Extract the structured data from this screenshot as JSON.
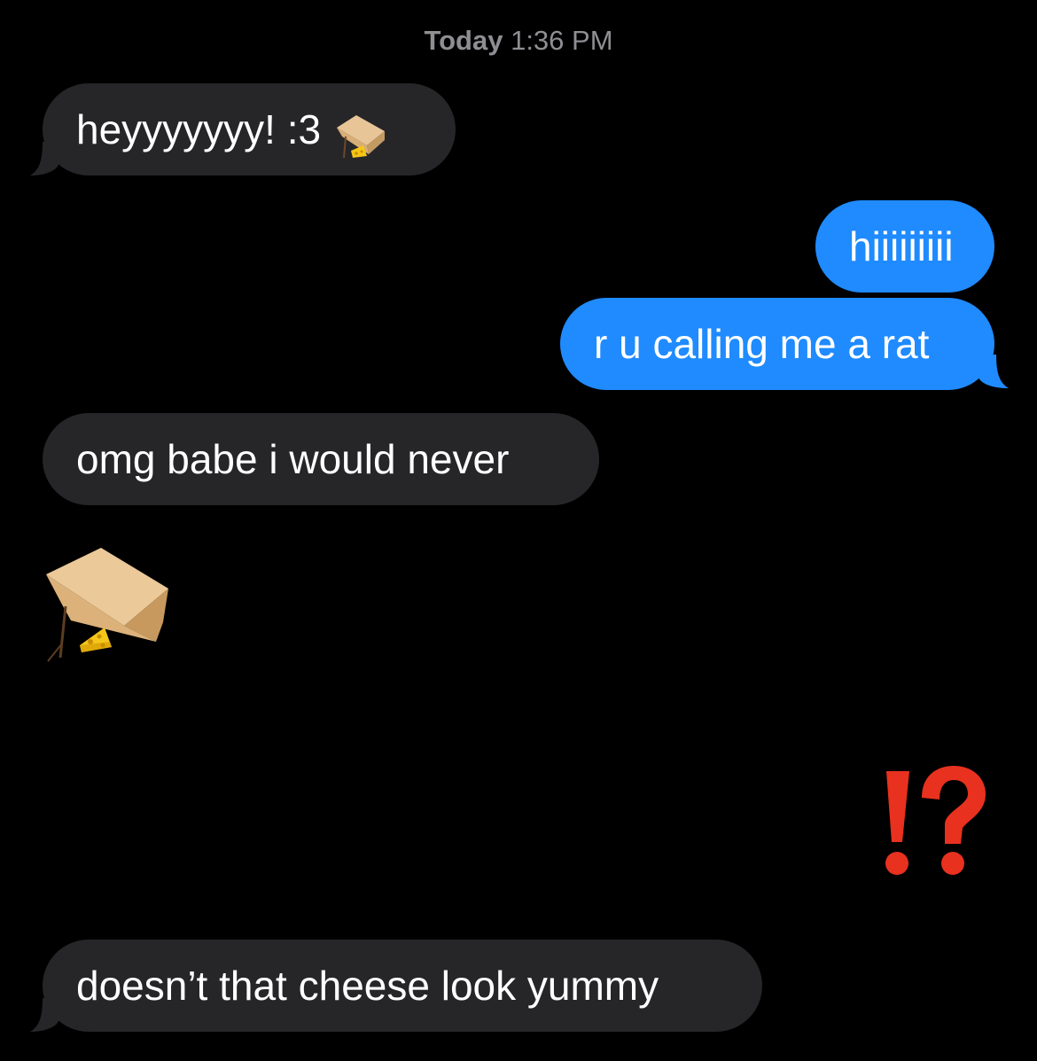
{
  "header": {
    "day": "Today",
    "time": "1:36 PM"
  },
  "messages": [
    {
      "from": "them",
      "text": "heyyyyyyy! :3",
      "emoji": "mousetrap-icon"
    },
    {
      "from": "me",
      "text": "hiiiiiiiii"
    },
    {
      "from": "me",
      "text": "r u calling me a rat"
    },
    {
      "from": "them",
      "text": "omg babe i would never"
    },
    {
      "from": "them",
      "emoji": "mousetrap-icon"
    },
    {
      "from": "me",
      "emoji": "interrobang-icon"
    },
    {
      "from": "them",
      "text": "doesn’t that cheese look yummy"
    }
  ],
  "colors": {
    "background": "#000000",
    "incoming_bubble": "#262629",
    "outgoing_bubble": "#1f8bff",
    "timestamp": "#8e8e93",
    "interrobang": "#e8311f"
  }
}
